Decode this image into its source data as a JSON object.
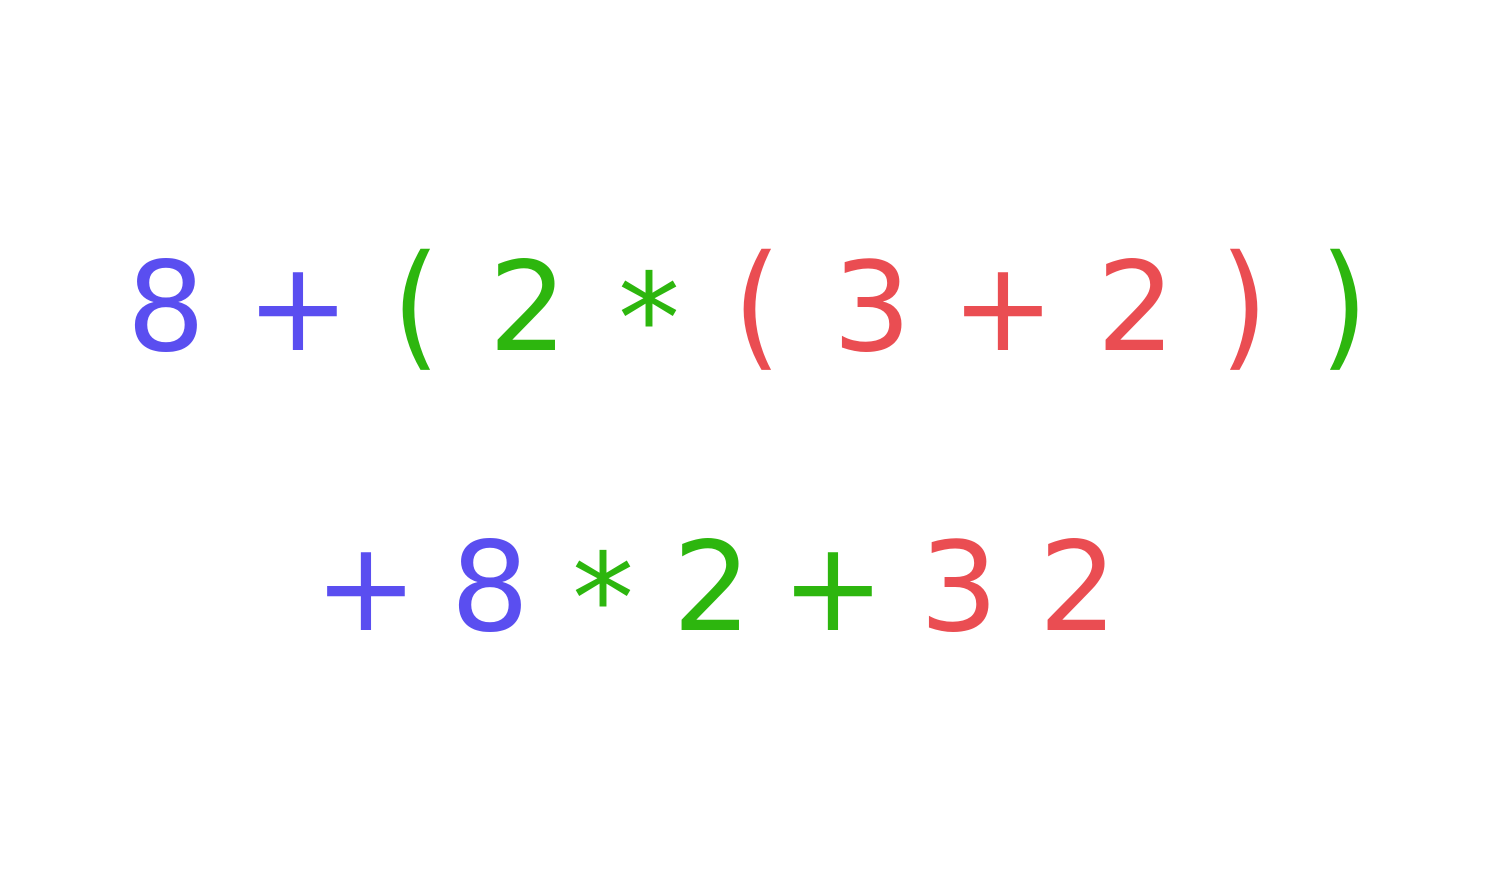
{
  "colors": {
    "outer": "#5a4ef0",
    "middle": "#2db60e",
    "inner": "#ea4d52",
    "background": "#ffffff"
  },
  "infix_expression": {
    "tokens": [
      {
        "text": "8",
        "level": "outer"
      },
      {
        "text": "+",
        "level": "outer"
      },
      {
        "text": "(",
        "level": "middle"
      },
      {
        "text": "2",
        "level": "middle"
      },
      {
        "text": "*",
        "level": "middle"
      },
      {
        "text": "(",
        "level": "inner"
      },
      {
        "text": "3",
        "level": "inner"
      },
      {
        "text": "+",
        "level": "inner"
      },
      {
        "text": "2",
        "level": "inner"
      },
      {
        "text": ")",
        "level": "inner"
      },
      {
        "text": ")",
        "level": "middle"
      }
    ]
  },
  "prefix_expression": {
    "tokens": [
      {
        "text": "+",
        "level": "outer"
      },
      {
        "text": "8",
        "level": "outer"
      },
      {
        "text": "*",
        "level": "middle"
      },
      {
        "text": "2",
        "level": "middle"
      },
      {
        "text": "+",
        "level": "middle"
      },
      {
        "text": "3",
        "level": "inner"
      },
      {
        "text": "2",
        "level": "inner"
      }
    ]
  }
}
